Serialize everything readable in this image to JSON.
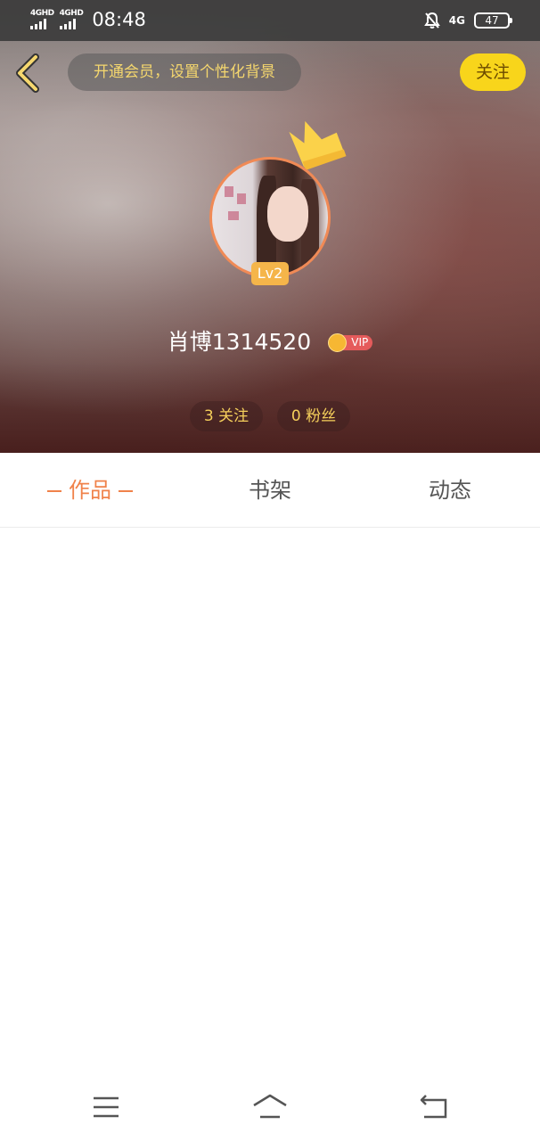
{
  "status_bar": {
    "sim1_label": "4GHD",
    "sim2_label": "4GHD",
    "time": "08:48",
    "network": "4G",
    "battery": "47"
  },
  "header": {
    "promo_text": "开通会员，设置个性化背景",
    "follow_label": "关注"
  },
  "profile": {
    "level": "Lv2",
    "username": "肖博1314520",
    "vip_label": "VIP",
    "following_label": "3 关注",
    "fans_label": "0 粉丝"
  },
  "tabs": {
    "works": "作品",
    "shelf": "书架",
    "feed": "动态"
  },
  "colors": {
    "accent": "#f0824a",
    "follow_button": "#f8d51b",
    "stat_text": "#f5cf5b"
  },
  "icons": {
    "back": "chevron-left-icon",
    "crown": "crown-icon",
    "menu": "menu-icon",
    "home": "home-icon",
    "return": "return-icon"
  }
}
